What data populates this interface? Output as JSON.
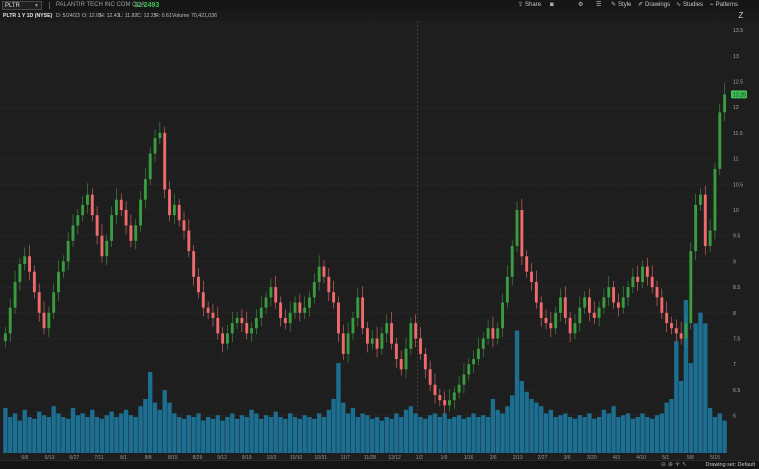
{
  "toolbar": {
    "symbol": "PLTR",
    "company": "PALANTIR TECH INC COM CL A",
    "last_price": "12.2493",
    "buttons": [
      {
        "label": "Share",
        "icon": "share-icon"
      },
      {
        "label": "",
        "icon": "camera-icon"
      },
      {
        "label": "",
        "icon": "gear-icon"
      },
      {
        "label": "",
        "icon": "menu-icon"
      },
      {
        "label": "Style",
        "icon": "style-icon"
      },
      {
        "label": "Drawings",
        "icon": "drawings-icon"
      },
      {
        "label": "Studies",
        "icon": "studies-icon"
      },
      {
        "label": "Patterns",
        "icon": "patterns-icon"
      }
    ]
  },
  "infobar": {
    "title": "PLTR 1 Y 1D (NYSE)",
    "date": "D: 5/24/23",
    "open": "O: 12.05",
    "high": "H: 12.43",
    "low": "L: 11.82",
    "close": "C: 12.25",
    "range": "R: 0.61",
    "volume_label": "Volume",
    "volume_value": "70,421,036"
  },
  "status": {
    "drawing_set": "Drawing set: Default"
  },
  "colors": {
    "up": "#3a9b3f",
    "down": "#ef6b6b",
    "volume": "#1d6f92",
    "price_tag": "#3cc156",
    "background": "#1e1e1e"
  },
  "chart_data": {
    "type": "candlestick",
    "ylim": [
      5.7,
      13.6
    ],
    "y_ticks": [
      "6",
      "6.5",
      "7",
      "7.5",
      "8",
      "8.5",
      "9",
      "9.5",
      "10",
      "10.5",
      "11",
      "11.5",
      "12",
      "12.5",
      "13",
      "13.5"
    ],
    "current_price_tag": "12.25",
    "x_labels": [
      "6/6",
      "6/13",
      "6/27",
      "7/11",
      "8/1",
      "8/8",
      "8/15",
      "8/29",
      "9/12",
      "9/19",
      "10/3",
      "10/10",
      "10/31",
      "11/7",
      "11/28",
      "12/12",
      "1/2",
      "1/9",
      "1/16",
      "2/6",
      "2/13",
      "2/27",
      "3/6",
      "3/20",
      "4/3",
      "4/10",
      "5/1",
      "5/8",
      "5/15"
    ],
    "closes": [
      7.6,
      8.1,
      8.6,
      8.95,
      9.1,
      8.8,
      8.4,
      8.0,
      7.7,
      8.0,
      8.4,
      8.8,
      9.0,
      9.4,
      9.7,
      9.9,
      10.1,
      10.3,
      9.9,
      9.5,
      9.1,
      9.4,
      9.9,
      10.2,
      10.0,
      9.7,
      9.4,
      9.7,
      10.2,
      10.6,
      11.1,
      11.4,
      11.5,
      10.4,
      9.9,
      10.1,
      9.8,
      9.6,
      9.2,
      8.7,
      8.4,
      8.1,
      8.0,
      7.9,
      7.6,
      7.4,
      7.6,
      7.8,
      7.9,
      7.8,
      7.6,
      7.7,
      7.9,
      8.1,
      8.3,
      8.5,
      8.2,
      7.9,
      7.8,
      8.0,
      8.2,
      8.0,
      8.1,
      8.3,
      8.6,
      8.9,
      8.7,
      8.4,
      8.2,
      7.6,
      7.2,
      7.6,
      7.9,
      8.3,
      7.7,
      7.4,
      7.5,
      7.3,
      7.6,
      7.8,
      7.4,
      7.1,
      6.9,
      7.3,
      7.8,
      7.5,
      7.2,
      6.9,
      6.6,
      6.4,
      6.3,
      6.2,
      6.3,
      6.45,
      6.6,
      6.8,
      7.0,
      7.1,
      7.3,
      7.5,
      7.7,
      7.5,
      7.7,
      8.2,
      8.7,
      9.3,
      10.0,
      9.1,
      8.8,
      8.6,
      8.2,
      7.9,
      7.8,
      7.7,
      8.0,
      8.3,
      7.9,
      7.6,
      7.8,
      8.1,
      8.3,
      8.0,
      7.9,
      8.1,
      8.3,
      8.5,
      8.2,
      8.1,
      8.3,
      8.5,
      8.7,
      8.6,
      8.9,
      8.7,
      8.5,
      8.3,
      8.0,
      7.8,
      7.7,
      7.6,
      7.5,
      7.8,
      9.2,
      10.1,
      10.3,
      9.3,
      9.6,
      10.8,
      11.9,
      12.25
    ],
    "volume_scale": "relative",
    "volumes": [
      0.25,
      0.2,
      0.22,
      0.18,
      0.24,
      0.2,
      0.19,
      0.23,
      0.21,
      0.2,
      0.26,
      0.22,
      0.2,
      0.19,
      0.25,
      0.21,
      0.22,
      0.2,
      0.24,
      0.2,
      0.19,
      0.21,
      0.23,
      0.2,
      0.22,
      0.24,
      0.21,
      0.2,
      0.26,
      0.3,
      0.45,
      0.28,
      0.24,
      0.35,
      0.28,
      0.22,
      0.2,
      0.19,
      0.21,
      0.2,
      0.22,
      0.18,
      0.2,
      0.19,
      0.21,
      0.18,
      0.2,
      0.22,
      0.19,
      0.21,
      0.2,
      0.24,
      0.22,
      0.19,
      0.21,
      0.2,
      0.23,
      0.2,
      0.19,
      0.22,
      0.2,
      0.19,
      0.21,
      0.2,
      0.19,
      0.22,
      0.2,
      0.24,
      0.3,
      0.5,
      0.28,
      0.22,
      0.25,
      0.2,
      0.22,
      0.21,
      0.19,
      0.2,
      0.18,
      0.2,
      0.19,
      0.22,
      0.2,
      0.24,
      0.26,
      0.22,
      0.2,
      0.19,
      0.21,
      0.22,
      0.2,
      0.22,
      0.19,
      0.2,
      0.21,
      0.19,
      0.2,
      0.22,
      0.2,
      0.21,
      0.2,
      0.3,
      0.24,
      0.22,
      0.26,
      0.32,
      0.68,
      0.4,
      0.34,
      0.3,
      0.28,
      0.26,
      0.22,
      0.24,
      0.2,
      0.21,
      0.22,
      0.2,
      0.19,
      0.21,
      0.2,
      0.22,
      0.19,
      0.2,
      0.24,
      0.22,
      0.26,
      0.2,
      0.21,
      0.22,
      0.19,
      0.2,
      0.22,
      0.2,
      0.19,
      0.21,
      0.22,
      0.28,
      0.3,
      0.62,
      0.4,
      0.85,
      0.5,
      0.72,
      0.78,
      0.72
    ]
  }
}
